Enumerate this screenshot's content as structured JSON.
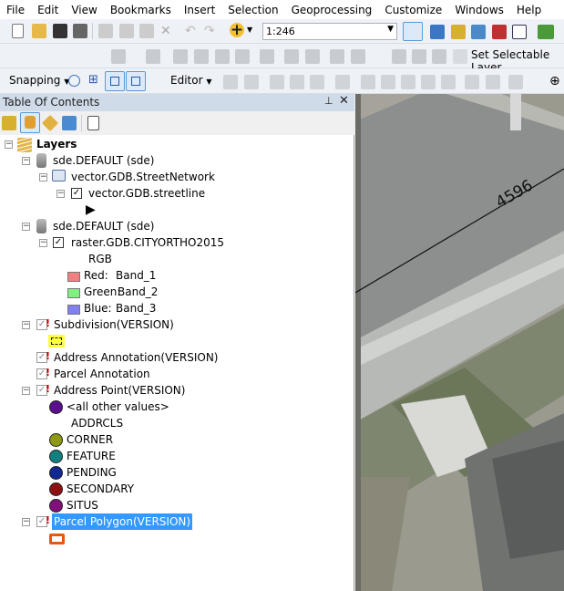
{
  "menu": [
    "File",
    "Edit",
    "View",
    "Bookmarks",
    "Insert",
    "Selection",
    "Geoprocessing",
    "Customize",
    "Windows",
    "Help"
  ],
  "toolbar": {
    "scale": "1:246",
    "set_selectable": "Set Selectable Layer",
    "snapping": "Snapping",
    "editor": "Editor"
  },
  "toc": {
    "title": "Table Of Contents",
    "root": "Layers",
    "db1": "sde.DEFAULT (sde)",
    "group": "vector.GDB.StreetNetwork",
    "streetline": "vector.GDB.streetline",
    "db2": "sde.DEFAULT (sde)",
    "raster": "raster.GDB.CITYORTHO2015",
    "rgb": "RGB",
    "bands": [
      {
        "label": "Red:",
        "band": "Band_1",
        "color": "#f08080"
      },
      {
        "label": "Green:",
        "band": "Band_2",
        "color": "#80f080"
      },
      {
        "label": "Blue:",
        "band": "Band_3",
        "color": "#8080f0"
      }
    ],
    "subdivision": "Subdivision(VERSION)",
    "addr_anno": "Address Annotation(VERSION)",
    "parcel_anno": "Parcel Annotation",
    "addr_point": "Address Point(VERSION)",
    "all_other": "<all other values>",
    "field": "ADDRCLS",
    "classes": [
      {
        "label": "CORNER",
        "color": "#8f9a12"
      },
      {
        "label": "FEATURE",
        "color": "#138080"
      },
      {
        "label": "PENDING",
        "color": "#10288f"
      },
      {
        "label": "SECONDARY",
        "color": "#8f1010"
      },
      {
        "label": "SITUS",
        "color": "#80107a"
      }
    ],
    "all_other_color": "#5a0f8f",
    "parcel_poly": "Parcel Polygon(VERSION)",
    "selected_color": "#3399ff"
  },
  "map": {
    "label": "4596"
  }
}
